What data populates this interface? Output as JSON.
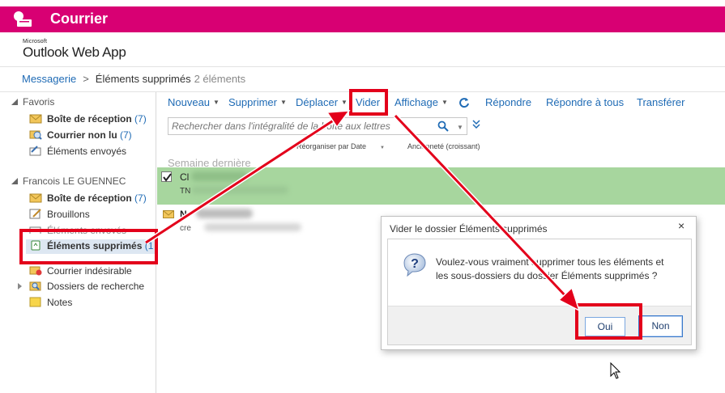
{
  "app": {
    "title": "Courrier",
    "brand_color": "#d80073",
    "logo_small": "Microsoft",
    "logo_name": "Outlook Web App"
  },
  "breadcrumb": {
    "root": "Messagerie",
    "separator": ">",
    "current": "Éléments supprimés",
    "count": "2 éléments"
  },
  "sidebar": {
    "favorites_label": "Favoris",
    "favorites": [
      {
        "label": "Boîte de réception",
        "count": "(7)",
        "icon": "inbox-icon"
      },
      {
        "label": "Courrier non lu",
        "count": "(7)",
        "icon": "unread-mail-icon"
      },
      {
        "label": "Éléments envoyés",
        "count": "",
        "icon": "sent-items-icon"
      }
    ],
    "mailbox_label": "Francois LE GUENNEC",
    "folders": [
      {
        "label": "Boîte de réception",
        "count": "(7)",
        "icon": "inbox-icon"
      },
      {
        "label": "Brouillons",
        "count": "",
        "icon": "drafts-icon"
      },
      {
        "label": "Éléments envoyés",
        "count": "",
        "icon": "sent-items-icon"
      },
      {
        "label": "Éléments supprimés",
        "count": "(1",
        "icon": "recycle-bin-icon"
      },
      {
        "label": "Courrier indésirable",
        "count": "",
        "icon": "junk-mail-icon"
      },
      {
        "label": "Dossiers de recherche",
        "count": "",
        "icon": "search-folder-icon"
      },
      {
        "label": "Notes",
        "count": "",
        "icon": "notes-icon"
      }
    ]
  },
  "toolbar": {
    "new": "Nouveau",
    "delete": "Supprimer",
    "move": "Déplacer",
    "empty": "Vider",
    "view": "Affichage",
    "reply": "Répondre",
    "reply_all": "Répondre à tous",
    "forward": "Transférer",
    "refresh_icon": "refresh-icon"
  },
  "search": {
    "placeholder": "Rechercher dans l'intégralité de la boîte aux lettres"
  },
  "sort": {
    "by": "Réorganiser par Date",
    "order": "Ancienneté (croissant)"
  },
  "messages": {
    "group": "Semaine dernière",
    "item1_from": "Cl",
    "item1_preview": "TN",
    "item2_from": "N",
    "item2_preview": "cre"
  },
  "dialog": {
    "title": "Vider le dossier Éléments supprimés",
    "close": "×",
    "message": "Voulez-vous vraiment supprimer tous les éléments et les sous-dossiers du dossier Éléments supprimés ?",
    "yes": "Oui",
    "no": "Non"
  },
  "annotation_color": "#e3001b"
}
